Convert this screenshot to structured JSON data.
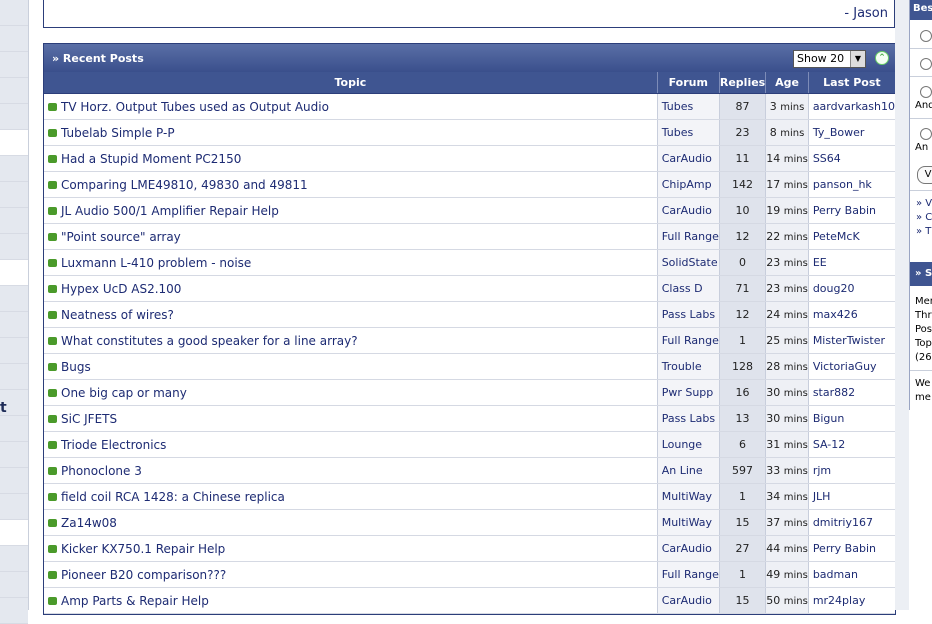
{
  "quote": {
    "author": "- Jason"
  },
  "recent_posts": {
    "title": "» Recent Posts",
    "show_select": "Show 20",
    "columns": {
      "topic": "Topic",
      "forum": "Forum",
      "replies": "Replies",
      "age": "Age",
      "last_post": "Last Post"
    },
    "rows": [
      {
        "topic": "TV Horz. Output Tubes used as Output Audio",
        "forum": "Tubes",
        "replies": "87",
        "age": "3",
        "last": "aardvarkash10"
      },
      {
        "topic": "Tubelab Simple P-P",
        "forum": "Tubes",
        "replies": "23",
        "age": "8",
        "last": "Ty_Bower"
      },
      {
        "topic": "Had a Stupid Moment PC2150",
        "forum": "CarAudio",
        "replies": "11",
        "age": "14",
        "last": "SS64"
      },
      {
        "topic": "Comparing LME49810, 49830 and 49811",
        "forum": "ChipAmp",
        "replies": "142",
        "age": "17",
        "last": "panson_hk"
      },
      {
        "topic": "JL Audio 500/1 Amplifier Repair Help",
        "forum": "CarAudio",
        "replies": "10",
        "age": "19",
        "last": "Perry Babin"
      },
      {
        "topic": "\"Point source\" array",
        "forum": "Full Range",
        "replies": "12",
        "age": "22",
        "last": "PeteMcK"
      },
      {
        "topic": "Luxmann L-410 problem - noise",
        "forum": "SolidState",
        "replies": "0",
        "age": "23",
        "last": "EE"
      },
      {
        "topic": "Hypex UcD AS2.100",
        "forum": "Class D",
        "replies": "71",
        "age": "23",
        "last": "doug20"
      },
      {
        "topic": "Neatness of wires?",
        "forum": "Pass Labs",
        "replies": "12",
        "age": "24",
        "last": "max426"
      },
      {
        "topic": "What constitutes a good speaker for a line array?",
        "forum": "Full Range",
        "replies": "1",
        "age": "25",
        "last": "MisterTwister"
      },
      {
        "topic": "Bugs",
        "forum": "Trouble",
        "replies": "128",
        "age": "28",
        "last": "VictoriaGuy"
      },
      {
        "topic": "One big cap or many",
        "forum": "Pwr Supp",
        "replies": "16",
        "age": "30",
        "last": "star882"
      },
      {
        "topic": "SiC JFETS",
        "forum": "Pass Labs",
        "replies": "13",
        "age": "30",
        "last": "Bigun"
      },
      {
        "topic": "Triode Electronics",
        "forum": "Lounge",
        "replies": "6",
        "age": "31",
        "last": "SA-12"
      },
      {
        "topic": "Phonoclone 3",
        "forum": "An Line",
        "replies": "597",
        "age": "33",
        "last": "rjm"
      },
      {
        "topic": "field coil RCA 1428: a Chinese replica",
        "forum": "MultiWay",
        "replies": "1",
        "age": "34",
        "last": "JLH"
      },
      {
        "topic": "Za14w08",
        "forum": "MultiWay",
        "replies": "15",
        "age": "37",
        "last": "dmitriy167"
      },
      {
        "topic": "Kicker KX750.1 Repair Help",
        "forum": "CarAudio",
        "replies": "27",
        "age": "44",
        "last": "Perry Babin"
      },
      {
        "topic": "Pioneer B20 comparison???",
        "forum": "Full Range",
        "replies": "1",
        "age": "49",
        "last": "badman"
      },
      {
        "topic": "Amp Parts & Repair Help",
        "forum": "CarAudio",
        "replies": "15",
        "age": "50",
        "last": "mr24play"
      }
    ],
    "age_unit": "mins"
  },
  "right": {
    "head1": "Bes",
    "opt3": "And",
    "opt4": "An",
    "vote": "V",
    "links": [
      "» V",
      "» C",
      "» T"
    ],
    "head2": "» S",
    "stats": [
      "Mer",
      "Thr",
      "Pos",
      "Top",
      "(26"
    ],
    "welcome": [
      "We",
      "me"
    ]
  },
  "left": {
    "marker": "t"
  }
}
